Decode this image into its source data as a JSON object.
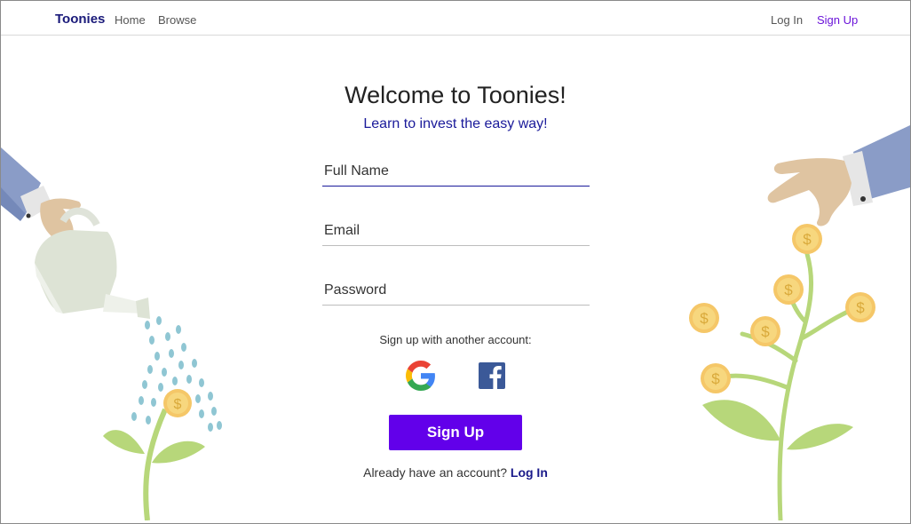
{
  "nav": {
    "brand": "Toonies",
    "home": "Home",
    "browse": "Browse",
    "login": "Log In",
    "signup": "Sign Up"
  },
  "hero": {
    "title": "Welcome to Toonies!",
    "subtitle": "Learn to invest the easy way!"
  },
  "form": {
    "full_name_placeholder": "Full Name",
    "email_placeholder": "Email",
    "password_placeholder": "Password",
    "alt_signup_text": "Sign up with another account:",
    "submit_label": "Sign Up",
    "already_text": "Already have an account?",
    "login_link": "Log In"
  },
  "icons": {
    "google": "google-icon",
    "facebook": "facebook-icon",
    "coin": "dollar-coin-icon"
  },
  "colors": {
    "brand": "#1a1a7a",
    "accent": "#6200ea",
    "signup_nav": "#6b14d9",
    "subtitle": "#1a1a9a",
    "leaf": "#b7d77a",
    "coin": "#f7d77e",
    "sleeve": "#8a9cc7"
  }
}
